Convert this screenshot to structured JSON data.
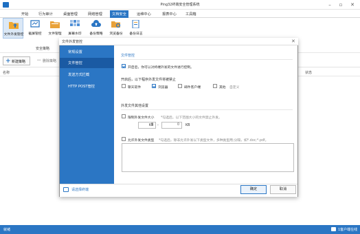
{
  "app": {
    "title": "Ping32终端安全管理系统"
  },
  "menu": [
    "开始",
    "行为审计",
    "桌面管理",
    "网络管理",
    "文档安全",
    "运维中心",
    "报表中心",
    "工具箱"
  ],
  "menu_active_index": 4,
  "ribbon": {
    "buttons": [
      "文件外发管控",
      "截屏管控",
      "文件管理",
      "屏幕水印",
      "备份策略",
      "浏览备份",
      "备份日志"
    ],
    "selected_index": 0,
    "group_label": "安全策略"
  },
  "toolbar": {
    "new_label": "新建策略",
    "delete_label": "删除策略"
  },
  "list": {
    "col_name": "名称",
    "col_status": "状态"
  },
  "dialog": {
    "title": "文件外发管控",
    "nav": [
      "常规设置",
      "文件管控",
      "发送方式拦截",
      "HTTP POST管控"
    ],
    "nav_active_index": 1,
    "content": {
      "section_title": "文件管控",
      "enable_label": "开启后，你可以对终端外发的文件进行控制。",
      "enable_checked": true,
      "programs_title": "开启后，以下程序外发文件将被禁止",
      "programs": [
        {
          "label": "聊天软件",
          "checked": false
        },
        {
          "label": "浏览器",
          "checked": true
        },
        {
          "label": "邮件客户端",
          "checked": false
        },
        {
          "label": "其他",
          "checked": false
        }
      ],
      "custom_label": "自定义",
      "other_section_title": "外发文件其他设置",
      "size_limit_label": "限制外发文件大小",
      "size_limit_hint": "*勾选后，以下范围大小的文件禁止外发。",
      "size_min": "0",
      "size_max": "0",
      "kb_unit": "KB",
      "range_sep": "-",
      "type_allow_label": "允许外发文件类型",
      "type_allow_hint": "*勾选后，除非允许外发以下类型文件，多种类型用;分隔，如*.doc;*.pdf。"
    },
    "footer_link": "请选择终端",
    "ok_label": "确定",
    "cancel_label": "取消"
  },
  "status": {
    "left": "就绪",
    "right": "1客户端在线"
  },
  "colors": {
    "accent": "#2b76c4",
    "nav_active": "#1a5aa3"
  }
}
